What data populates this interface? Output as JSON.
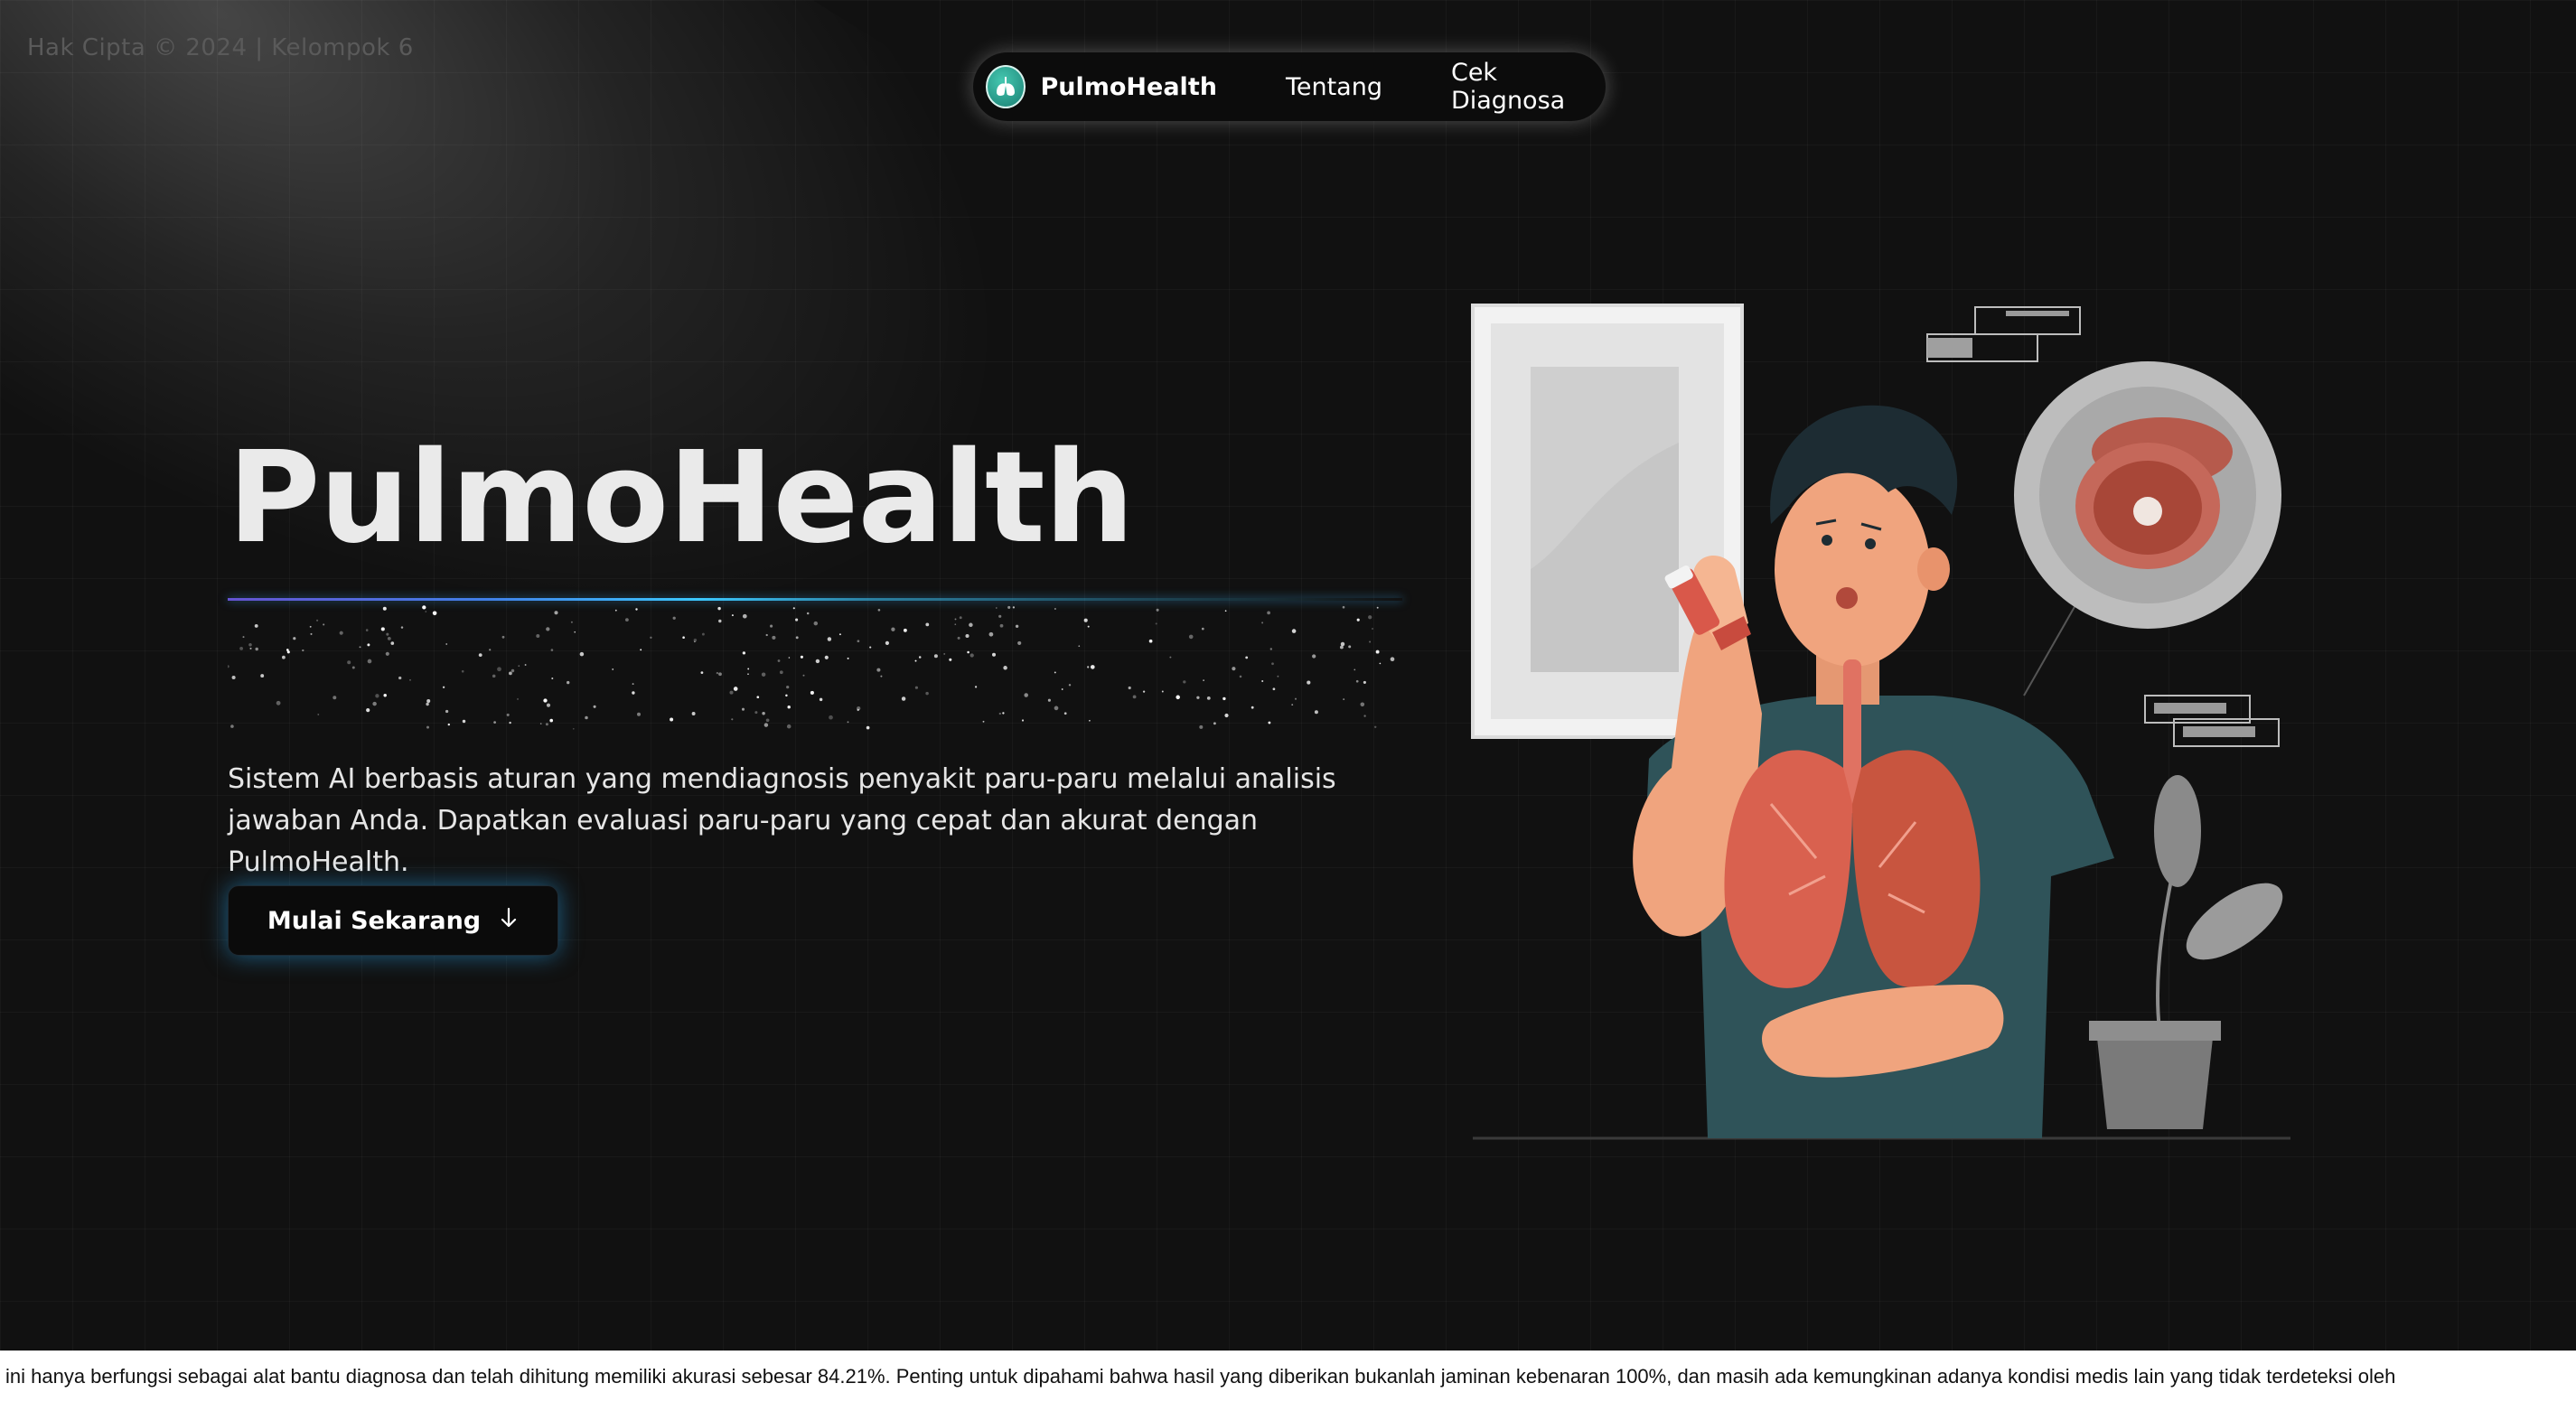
{
  "copyright": "Hak Cipta © 2024 | Kelompok 6",
  "nav": {
    "logo_icon": "lungs-icon",
    "brand": "PulmoHealth",
    "links": [
      "Tentang",
      "Cek Diagnosa"
    ]
  },
  "hero": {
    "title": "PulmoHealth",
    "description": "Sistem AI berbasis aturan yang mendiagnosis penyakit paru-paru melalui analisis jawaban Anda. Dapatkan evaluasi paru-paru yang cepat dan akurat dengan PulmoHealth.",
    "cta_label": "Mulai Sekarang",
    "cta_icon": "arrow-down-icon"
  },
  "illustration": {
    "icon": "man-with-inhaler-lungs-illustration"
  },
  "disclaimer": "ini hanya berfungsi sebagai alat bantu diagnosa dan telah dihitung memiliki akurasi sebesar 84.21%. Penting untuk dipahami bahwa hasil yang diberikan bukanlah jaminan kebenaran 100%, dan masih ada kemungkinan adanya kondisi medis lain yang tidak terdeteksi oleh",
  "colors": {
    "background": "#111111",
    "accent_glow": "#3cc8ff",
    "logo_teal": "#2aa596",
    "lung_red": "#d9614f",
    "shirt": "#2f5359"
  }
}
